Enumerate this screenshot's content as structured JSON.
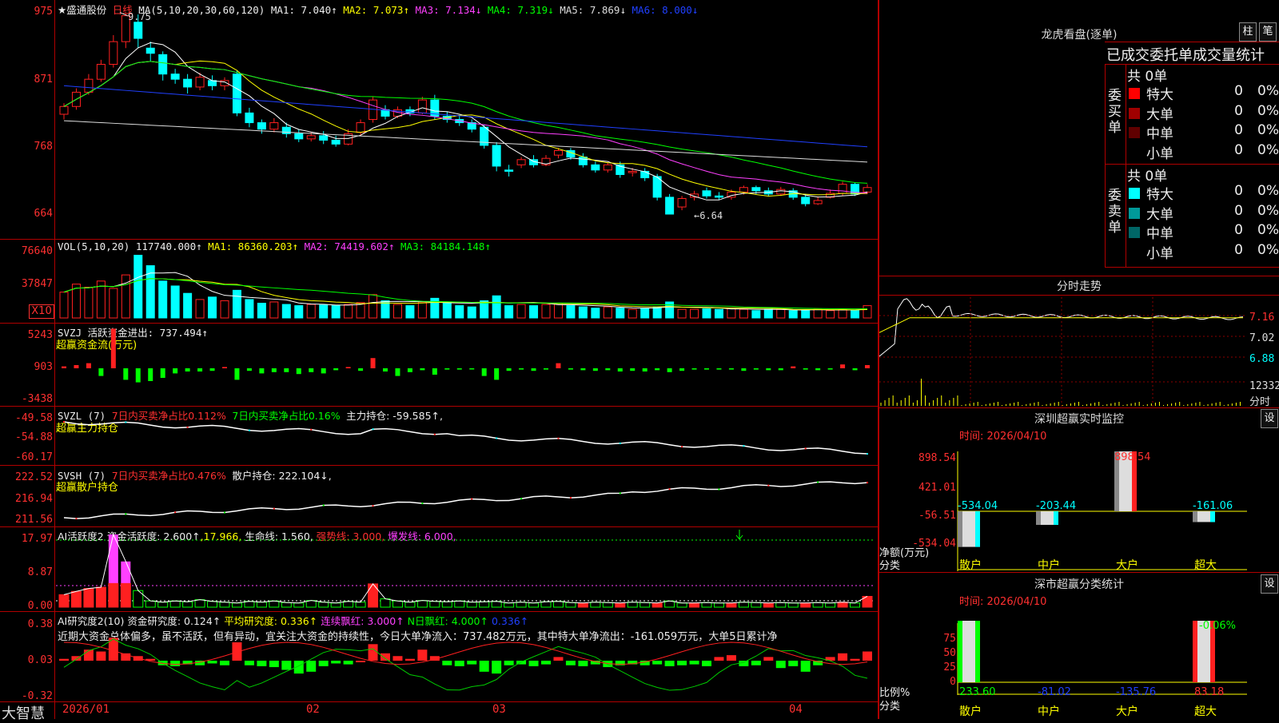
{
  "app": {
    "brand": "大智慧"
  },
  "kline": {
    "stock_name": "★盛通股份",
    "period": "日线",
    "ma_label": "MA(5,10,20,30,60,120)",
    "ma1": "MA1: 7.040↑",
    "ma2": "MA2: 7.073↑",
    "ma3": "MA3: 7.134↓",
    "ma4": "MA4: 7.319↓",
    "ma5": "MA5: 7.869↓",
    "ma6": "MA6: 8.000↓",
    "y_ticks": [
      "975",
      "871",
      "768",
      "664"
    ],
    "high_marker": "9.75",
    "low_marker": "←6.64"
  },
  "vol": {
    "label": "VOL(5,10,20)",
    "value": "117740.000↑",
    "ma1": "MA1: 86360.203↑",
    "ma2": "MA2: 74419.602↑",
    "ma3": "MA3: 84184.148↑",
    "y_ticks": [
      "76640",
      "37847"
    ],
    "unit": "X10"
  },
  "svzj": {
    "label": "SVZJ  活跃资金进出: 737.494↑",
    "sub": "超赢资金流(万元)",
    "y_ticks": [
      "5243",
      "903",
      "-3438"
    ]
  },
  "svzl": {
    "label": "SVZL (7)",
    "t1": "7日内买卖净占比0.112%",
    "t2": "7日内买卖净占比0.16%",
    "t3": "主力持仓: -59.585↑,",
    "sub": "超赢主力持仓",
    "y_ticks": [
      "-49.58",
      "-54.88",
      "-60.17"
    ]
  },
  "svsh": {
    "label": "SVSH (7)",
    "t1": "7日内买卖净占比0.476%",
    "t2": "散户持仓: 222.104↓,",
    "sub": "超赢散户持仓",
    "y_ticks": [
      "222.52",
      "216.94",
      "211.56"
    ]
  },
  "ai_active": {
    "label": "AI活跃度2",
    "t1": "资金活跃度: 2.600↑",
    "t2": ",17.966,",
    "t3": "生命线: 1.560,",
    "t4": "强势线: 3.000,",
    "t5": "爆发线: 6.000,",
    "y_ticks": [
      "17.97",
      "8.87",
      "0.00"
    ]
  },
  "ai_research": {
    "label": "AI研究度2(10)",
    "t1": "资金研究度: 0.124↑",
    "t2": "平均研究度: 0.336↑",
    "t3": "连续飘红: 3.000↑",
    "t4": "N日飘红: 4.000↑",
    "t5": "0.336↑",
    "text": "近期大资金总体偏多，虽不活跃，但有异动，宜关注大资金的持续性，今日大单净流入：737.482万元，其中特大单净流出：-161.059万元，大单5日累计净",
    "y_ticks": [
      "0.38",
      "0.03",
      "-0.32"
    ]
  },
  "x_dates": [
    "2026/01",
    "02",
    "03",
    "04"
  ],
  "dragon": {
    "title": "龙虎看盘(逐单)",
    "btn1": "柱",
    "btn2": "笔",
    "header": "已成交委托单成交量统计",
    "buy_total": "共 0单",
    "buy_label": "委买单",
    "sell_total": "共 0单",
    "sell_label": "委卖单",
    "buy_rows": [
      {
        "name": "特大",
        "vol": "0",
        "pct": "0%",
        "color": "#ff0000"
      },
      {
        "name": "大单",
        "vol": "0",
        "pct": "0%",
        "color": "#a00000"
      },
      {
        "name": "中单",
        "vol": "0",
        "pct": "0%",
        "color": "#600000"
      },
      {
        "name": "小单",
        "vol": "0",
        "pct": "0%",
        "color": "#000000"
      }
    ],
    "sell_rows": [
      {
        "name": "特大",
        "vol": "0",
        "pct": "0%",
        "color": "#00ffff"
      },
      {
        "name": "大单",
        "vol": "0",
        "pct": "0%",
        "color": "#009999"
      },
      {
        "name": "中单",
        "vol": "0",
        "pct": "0%",
        "color": "#006666"
      },
      {
        "name": "小单",
        "vol": "0",
        "pct": "0%",
        "color": "#000000"
      }
    ]
  },
  "intraday": {
    "title": "分时走势",
    "y_ticks": [
      "7.16",
      "7.02",
      "6.88"
    ],
    "vol_tick": "12332",
    "vol_unit": "分时"
  },
  "sz_monitor": {
    "title": "深圳超赢实时监控",
    "settings": "设",
    "time": "时间: 2026/04/10",
    "y_ticks": [
      "898.54",
      "421.01",
      "-56.51",
      "-534.04"
    ],
    "ylabel1": "净额(万元)",
    "ylabel2": "分类",
    "bars": [
      {
        "cat": "散户",
        "value": -534.04,
        "label": "-534.04"
      },
      {
        "cat": "中户",
        "value": -203.44,
        "label": "-203.44"
      },
      {
        "cat": "大户",
        "value": 898.54,
        "label": "898.54"
      },
      {
        "cat": "超大",
        "value": -161.06,
        "label": "-161.06"
      }
    ]
  },
  "sz_class": {
    "title": "深市超赢分类统计",
    "settings": "设",
    "time": "时间: 2026/04/10",
    "y_ticks": [
      "75",
      "50",
      "25",
      "0"
    ],
    "ylabel1": "比例%",
    "ylabel2": "分类",
    "top_label": "-0.06%",
    "bars": [
      {
        "cat": "散户",
        "value": "233.60"
      },
      {
        "cat": "中户",
        "value": "-81.02"
      },
      {
        "cat": "大户",
        "value": "-135.76"
      },
      {
        "cat": "超大",
        "value": "83.18"
      }
    ]
  }
}
